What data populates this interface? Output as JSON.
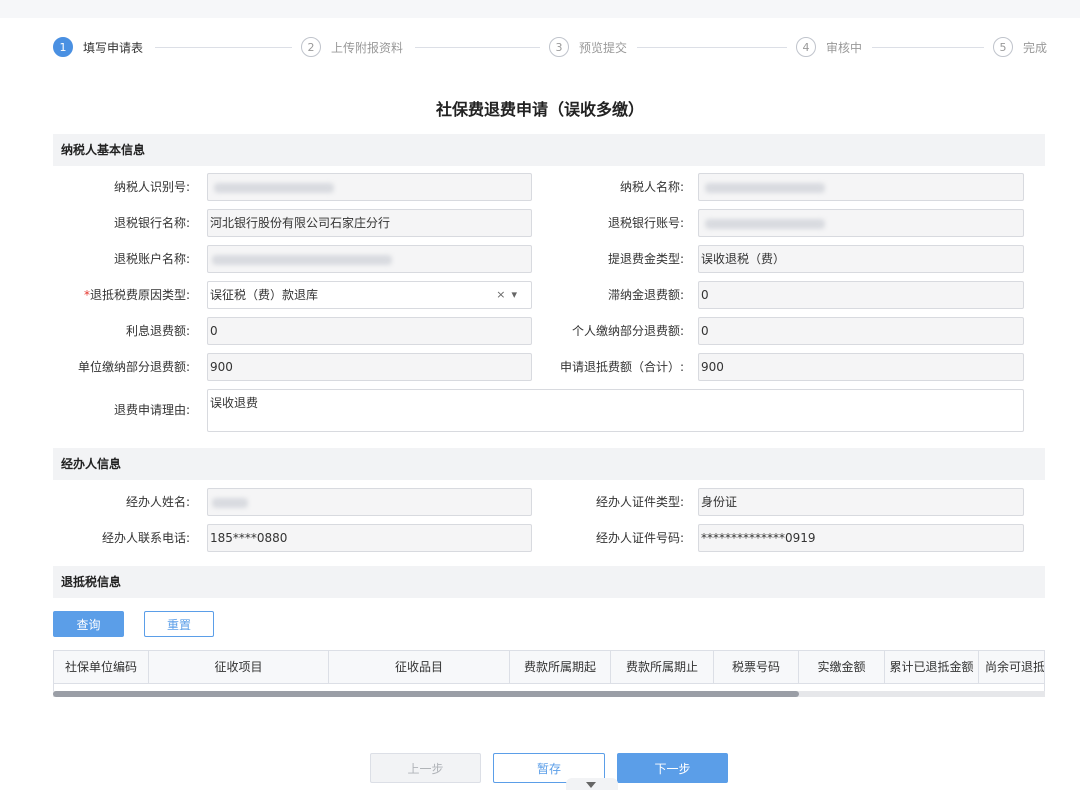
{
  "steps": [
    {
      "num": "1",
      "label": "填写申请表"
    },
    {
      "num": "2",
      "label": "上传附报资料"
    },
    {
      "num": "3",
      "label": "预览提交"
    },
    {
      "num": "4",
      "label": "审核中"
    },
    {
      "num": "5",
      "label": "完成"
    }
  ],
  "title": "社保费退费申请（误收多缴）",
  "sections": {
    "taxpayer": "纳税人基本信息",
    "agent": "经办人信息",
    "refund": "退抵税信息"
  },
  "taxpayer": {
    "taxpayer_id_label": "纳税人识别号:",
    "taxpayer_name_label": "纳税人名称:",
    "refund_bank_label": "退税银行名称:",
    "refund_bank_value": "河北银行股份有限公司石家庄分行",
    "refund_account_label": "退税银行账号:",
    "account_name_label": "退税账户名称:",
    "refund_type_label": "提退费金类型:",
    "refund_type_value": "误收退税（费）",
    "reason_type_label": "退抵税费原因类型:",
    "reason_type_value": "误征税（费）款退库",
    "late_fee_label": "滞纳金退费额:",
    "late_fee_value": "0",
    "interest_label": "利息退费额:",
    "interest_value": "0",
    "personal_label": "个人缴纳部分退费额:",
    "personal_value": "0",
    "unit_label": "单位缴纳部分退费额:",
    "unit_value": "900",
    "total_label": "申请退抵费额（合计）:",
    "total_value": "900",
    "reason_label": "退费申请理由:",
    "reason_value": "误收退费"
  },
  "agent": {
    "name_label": "经办人姓名:",
    "id_type_label": "经办人证件类型:",
    "id_type_value": "身份证",
    "phone_label": "经办人联系电话:",
    "phone_value": "185****0880",
    "id_no_label": "经办人证件号码:",
    "id_no_value": "**************0919"
  },
  "buttons": {
    "query": "查询",
    "reset": "重置",
    "prev": "上一步",
    "save": "暂存",
    "next": "下一步"
  },
  "table": {
    "columns": [
      "社保单位编码",
      "征收项目",
      "征收品目",
      "费款所属期起",
      "费款所属期止",
      "税票号码",
      "实缴金额",
      "累计已退抵金额",
      "尚余可退抵金额"
    ]
  },
  "icons": {
    "clear": "×",
    "dropdown": "▾"
  },
  "colors": {
    "primary": "#5b9ee8",
    "active_step": "#4a90e2",
    "required": "#e5372f"
  }
}
